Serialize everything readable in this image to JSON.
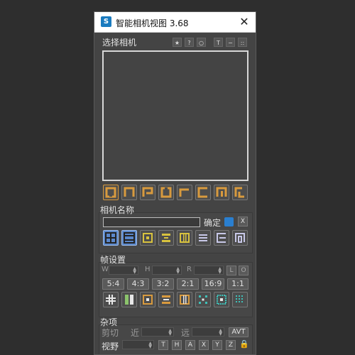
{
  "window": {
    "title": "智能相机视图 3.68",
    "app_icon": "S",
    "close_glyph": "✕"
  },
  "select_camera": {
    "label": "选择相机",
    "tools": [
      "★",
      "?",
      "○",
      "T",
      "−",
      "::"
    ]
  },
  "camera_name": {
    "label": "相机名称",
    "input_value": "",
    "confirm_label": "确定",
    "x_label": "X"
  },
  "frame_settings": {
    "label": "帧设置",
    "w_label": "W",
    "h_label": "H",
    "r_label": "R",
    "l_label": "L",
    "o_label": "O",
    "ratios": [
      "5:4",
      "4:3",
      "3:2",
      "2:1",
      "16:9",
      "1:1"
    ]
  },
  "misc": {
    "label": "杂项",
    "clip_label": "剪切",
    "near_label": "近",
    "far_label": "远",
    "avt_label": "AVT",
    "view_label": "视野",
    "letters": [
      "T",
      "H",
      "A",
      "X",
      "Y",
      "Z"
    ],
    "lock_glyph": "🔒"
  },
  "colors": {
    "accent_orange": "#d89a3e",
    "accent_blue": "#5b87c9",
    "accent_yellow": "#d8c23e",
    "accent_teal": "#3ec0b8"
  }
}
